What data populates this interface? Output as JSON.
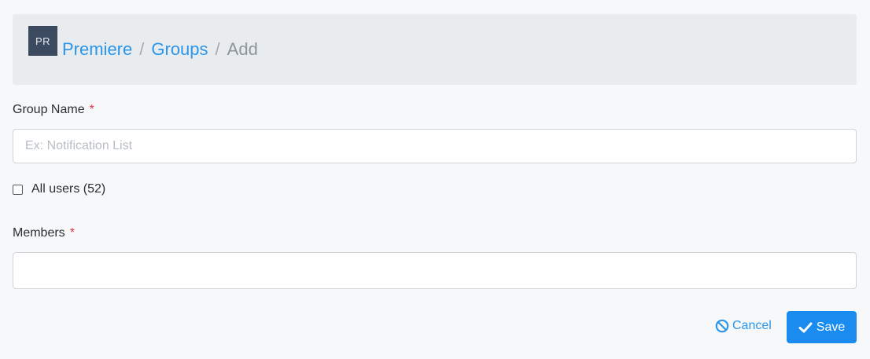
{
  "header": {
    "avatar_initials": "PR",
    "breadcrumb": {
      "items": [
        "Premiere",
        "Groups"
      ],
      "separator": "/",
      "current": "Add"
    }
  },
  "form": {
    "group_name": {
      "label": "Group Name",
      "required_mark": "*",
      "placeholder": "Ex: Notification List",
      "value": ""
    },
    "all_users": {
      "label": "All users (52)",
      "checked": false
    },
    "members": {
      "label": "Members",
      "required_mark": "*",
      "value": ""
    }
  },
  "actions": {
    "cancel_label": "Cancel",
    "save_label": "Save"
  },
  "icons": {
    "cancel": "ban-icon",
    "save": "check-icon"
  },
  "colors": {
    "accent": "#2b95e9",
    "primary_button": "#1a8cf0",
    "required": "#dc3545",
    "avatar_bg": "#3b4a5e",
    "header_bg": "#e9ecef"
  }
}
